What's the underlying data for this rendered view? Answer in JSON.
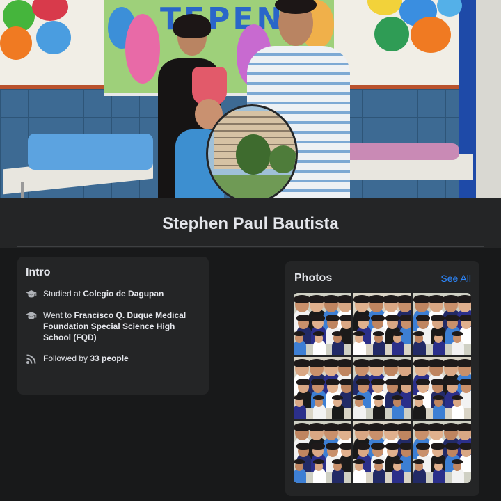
{
  "cover": {
    "banner_text": "TEPEN",
    "colors": {
      "wall_tiles": "#3d6a93",
      "banner": "#9ed07a",
      "post": "#1e4aa8"
    }
  },
  "profile": {
    "name": "Stephen Paul Bautista"
  },
  "intro": {
    "title": "Intro",
    "items": [
      {
        "icon": "graduation-cap-icon",
        "prefix": "Studied at ",
        "bold": "Colegio de Dagupan",
        "suffix": ""
      },
      {
        "icon": "graduation-cap-icon",
        "prefix": "Went to ",
        "bold": "Francisco Q. Duque Medical Foundation Special Science High School (FQD)",
        "suffix": ""
      },
      {
        "icon": "rss-feed-icon",
        "prefix": "Followed by ",
        "bold": "33 people",
        "suffix": ""
      }
    ]
  },
  "photos": {
    "title": "Photos",
    "see_all": "See All",
    "count": 9
  },
  "colors": {
    "background": "#18191a",
    "card": "#242526",
    "text": "#e4e6eb",
    "link": "#2d88ff",
    "icon": "#b0b3b8"
  }
}
